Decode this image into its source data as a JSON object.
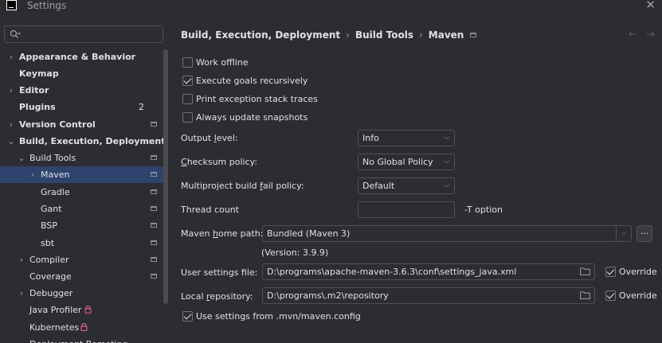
{
  "window": {
    "title": "Settings"
  },
  "search": {
    "placeholder": ""
  },
  "sidebar": {
    "items": [
      {
        "label": "Appearance & Behavior",
        "badge": ""
      },
      {
        "label": "Keymap",
        "badge": ""
      },
      {
        "label": "Editor",
        "badge": ""
      },
      {
        "label": "Plugins",
        "badge": "2"
      },
      {
        "label": "Version Control",
        "badge": ""
      },
      {
        "label": "Build, Execution, Deployment",
        "badge": ""
      },
      {
        "label": "Build Tools",
        "badge": ""
      },
      {
        "label": "Maven",
        "badge": ""
      },
      {
        "label": "Gradle",
        "badge": ""
      },
      {
        "label": "Gant",
        "badge": ""
      },
      {
        "label": "BSP",
        "badge": ""
      },
      {
        "label": "sbt",
        "badge": ""
      },
      {
        "label": "Compiler",
        "badge": ""
      },
      {
        "label": "Coverage",
        "badge": ""
      },
      {
        "label": "Debugger",
        "badge": ""
      },
      {
        "label": "Java Profiler",
        "badge": ""
      },
      {
        "label": "Kubernetes",
        "badge": ""
      },
      {
        "label": "Deployment Remoting",
        "badge": ""
      }
    ]
  },
  "breadcrumb": {
    "items": [
      "Build, Execution, Deployment",
      "Build Tools",
      "Maven"
    ]
  },
  "options": {
    "work_offline": {
      "label": "Work offline",
      "checked": false
    },
    "execute_recursively": {
      "label": "Execute goals recursively",
      "checked": true
    },
    "print_stack_traces": {
      "label": "Print exception stack traces",
      "checked": false
    },
    "always_update": {
      "label": "Always update snapshots",
      "checked": false
    },
    "use_mvn_config": {
      "label": "Use settings from .mvn/maven.config",
      "checked": true
    }
  },
  "fields": {
    "output_level": {
      "pre": "Output ",
      "mnemonic": "l",
      "post": "evel:",
      "value": "Info"
    },
    "checksum_policy": {
      "pre": "",
      "mnemonic": "C",
      "post": "hecksum policy:",
      "value": "No Global Policy"
    },
    "multiproject_policy": {
      "pre": "Multiproject build ",
      "mnemonic": "f",
      "post": "ail policy:",
      "value": "Default"
    },
    "thread_count": {
      "label": "Thread count",
      "value": "",
      "suffix": "-T option"
    },
    "maven_home": {
      "pre": "Maven ",
      "mnemonic": "h",
      "post": "ome path:",
      "value": "Bundled (Maven 3)",
      "version": "(Version: 3.9.9)",
      "browse": "..."
    },
    "user_settings": {
      "label": "User settings file:",
      "value": "D:\\programs\\apache-maven-3.6.3\\conf\\settings_java.xml",
      "override_label": "Override",
      "override_checked": true
    },
    "local_repo": {
      "pre": "Local ",
      "mnemonic": "r",
      "post": "epository:",
      "value": "D:\\programs\\.m2\\repository",
      "override_label": "Override",
      "override_checked": true
    }
  },
  "colors": {
    "background": "#2b2d30",
    "selection": "#2e436e",
    "text": "#dfe1e5",
    "border": "#4e5157",
    "lock": "#e05a9a"
  }
}
